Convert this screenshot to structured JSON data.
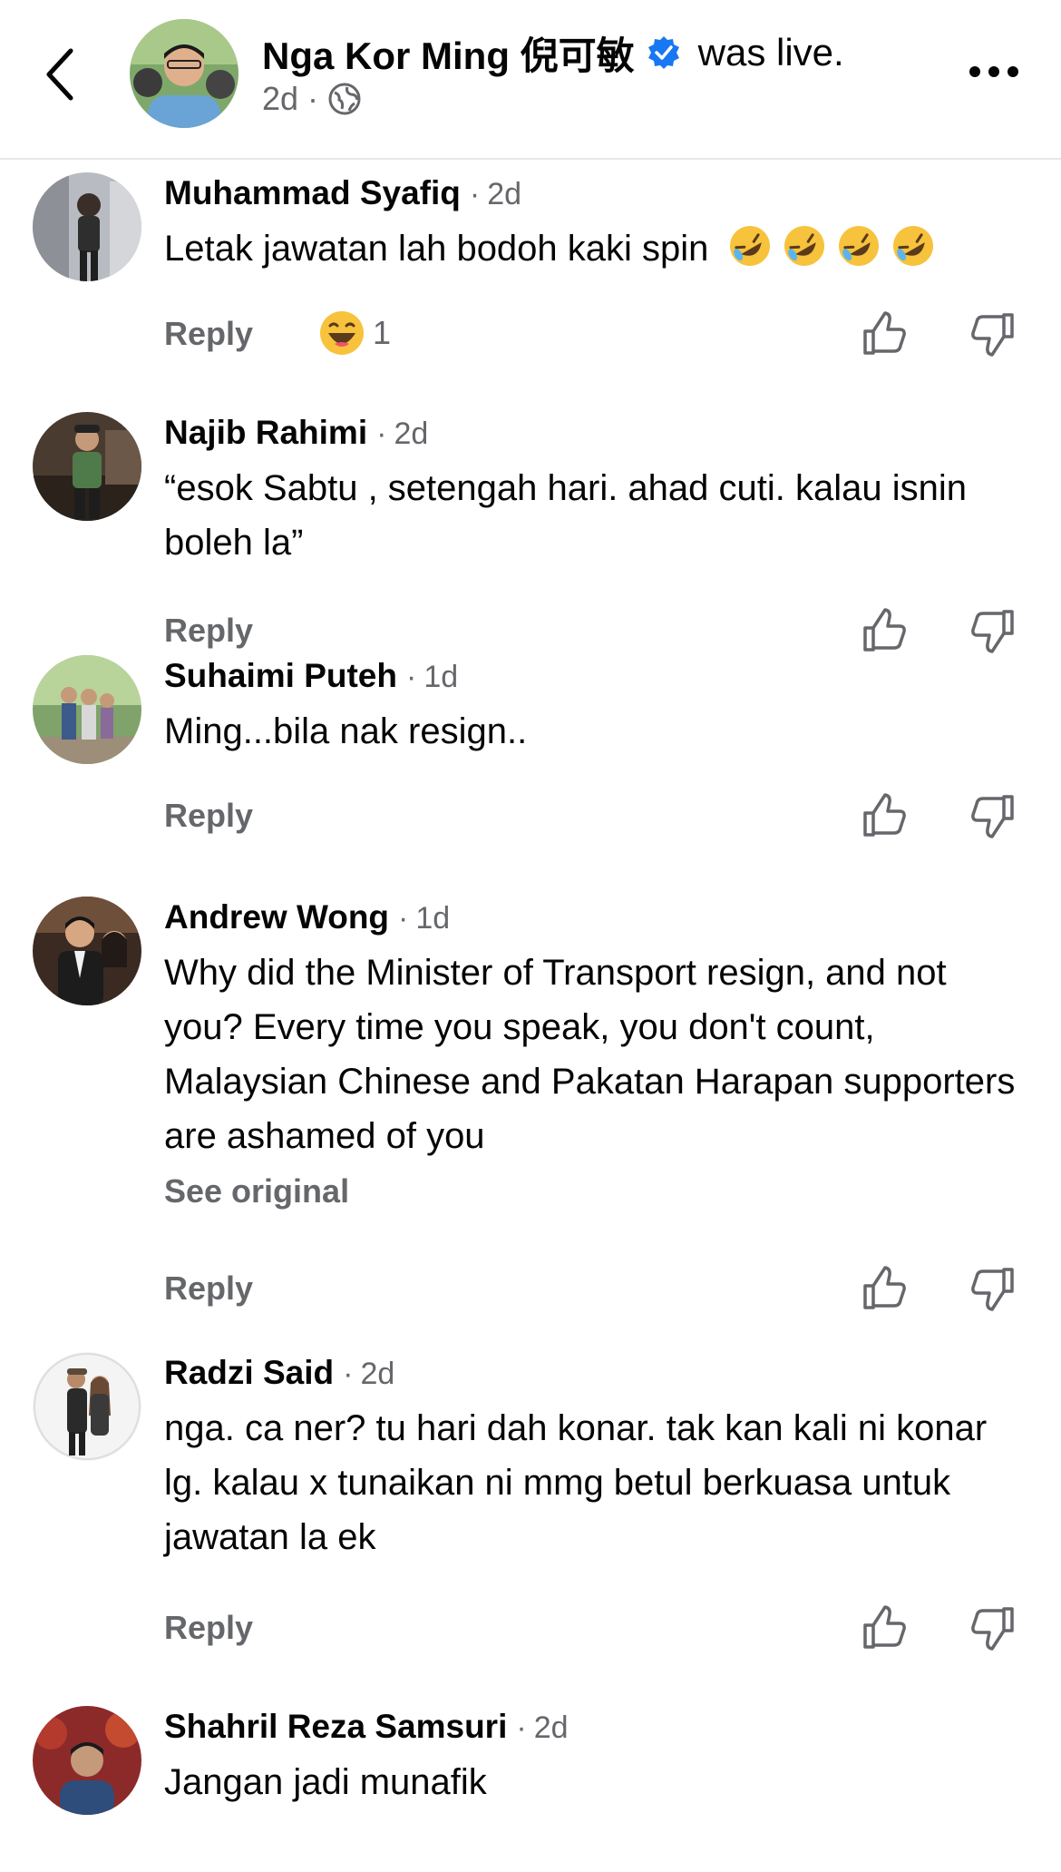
{
  "header": {
    "page_name": "Nga Kor Ming 倪可敏",
    "status_text": "was live.",
    "time": "2d",
    "dot": "·"
  },
  "ui": {
    "reply_label": "Reply",
    "see_original_label": "See original",
    "dot": "·"
  },
  "comments": [
    {
      "author": "Muhammad Syafiq",
      "time": "2d",
      "text": "Letak jawatan lah bodoh kaki spin",
      "emoji_count": 4,
      "reaction_count": "1"
    },
    {
      "author": "Najib Rahimi",
      "time": "2d",
      "text": "“esok Sabtu , setengah hari. ahad cuti. kalau isnin boleh la”"
    },
    {
      "author": "Suhaimi Puteh",
      "time": "1d",
      "text": "Ming...bila nak resign.."
    },
    {
      "author": "Andrew Wong",
      "time": "1d",
      "text": "Why did the Minister of Transport resign, and not you? Every time you speak, you don't count, Malaysian Chinese and Pakatan Harapan supporters are ashamed of you",
      "see_original": true
    },
    {
      "author": "Radzi Said",
      "time": "2d",
      "text": "nga. ca ner? tu hari dah konar. tak kan kali ni konar lg. kalau x tunaikan ni mmg betul berkuasa untuk jawatan la ek"
    },
    {
      "author": "Shahril Reza Samsuri",
      "time": "2d",
      "text": "Jangan jadi munafik"
    }
  ],
  "colors": {
    "text_primary": "#050505",
    "text_secondary": "#65676b",
    "verified_blue": "#1877f2",
    "divider": "#e4e6eb"
  },
  "icons": {
    "back": "chevron-left-icon",
    "verified": "verified-badge-icon",
    "audience": "globe-icon",
    "more": "more-dots-icon",
    "like": "thumbs-up-icon",
    "dislike": "thumbs-down-icon",
    "reaction": "haha-reaction-icon",
    "emoji": "rolling-laughing-emoji"
  }
}
